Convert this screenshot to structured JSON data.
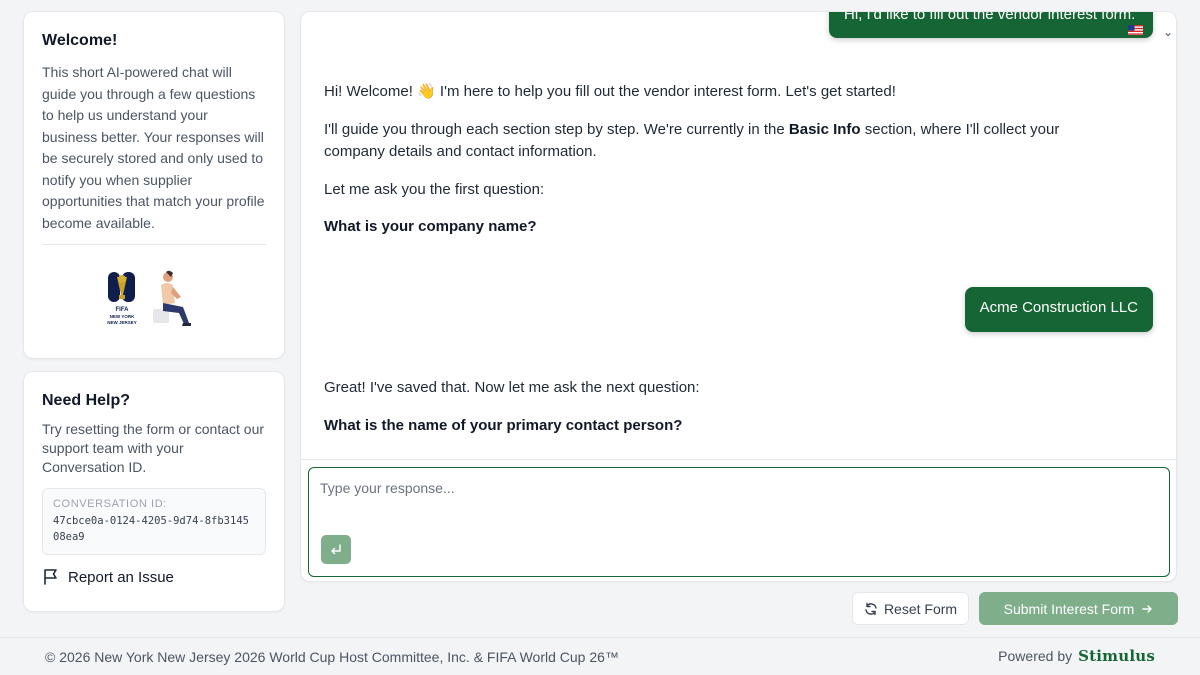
{
  "welcome": {
    "title": "Welcome!",
    "body": "This short AI-powered chat will guide you through a few questions to help us understand your business better. Your responses will be securely stored and only used to notify you when supplier opportunities that match your profile become available.",
    "logo_lines": [
      "FIFA",
      "NEW YORK",
      "NEW JERSEY"
    ]
  },
  "help": {
    "title": "Need Help?",
    "body": "Try resetting the form or contact our support team with your Conversation ID.",
    "conversation_label": "CONVERSATION ID:",
    "conversation_id": "47cbce0a-0124-4205-9d74-8fb314508ea9",
    "report_label": "Report an Issue"
  },
  "chat": {
    "user_first": "Hi, I'd like to fill out the vendor interest form.",
    "ai_1": {
      "line1": "Hi! Welcome! 👋 I'm here to help you fill out the vendor interest form. Let's get started!",
      "line2_pre": "I'll guide you through each section step by step. We're currently in the ",
      "line2_bold": "Basic Info",
      "line2_post": " section, where I'll collect your company details and contact information.",
      "line3": "Let me ask you the first question:",
      "question": "What is your company name?"
    },
    "user_answer": "Acme Construction LLC",
    "ai_2": {
      "line1": "Great! I've saved that. Now let me ask the next question:",
      "question": "What is the name of your primary contact person?"
    },
    "input_placeholder": "Type your response...",
    "input_value": ""
  },
  "actions": {
    "reset_label": "Reset Form",
    "submit_label": "Submit Interest Form"
  },
  "footer": {
    "copyright": "© 2026 New York New Jersey 2026 World Cup Host Committee, Inc. & FIFA World Cup 26™",
    "powered_by": "Powered by",
    "brand": "Stimulus"
  },
  "colors": {
    "brand_green": "#166534",
    "disabled_green": "#7fae8a"
  },
  "icons": [
    "world-cup-logo",
    "seated-person-illustration",
    "flag-icon",
    "us-flag-icon",
    "chevron-down-icon",
    "enter-icon",
    "refresh-icon",
    "arrow-right-icon"
  ]
}
